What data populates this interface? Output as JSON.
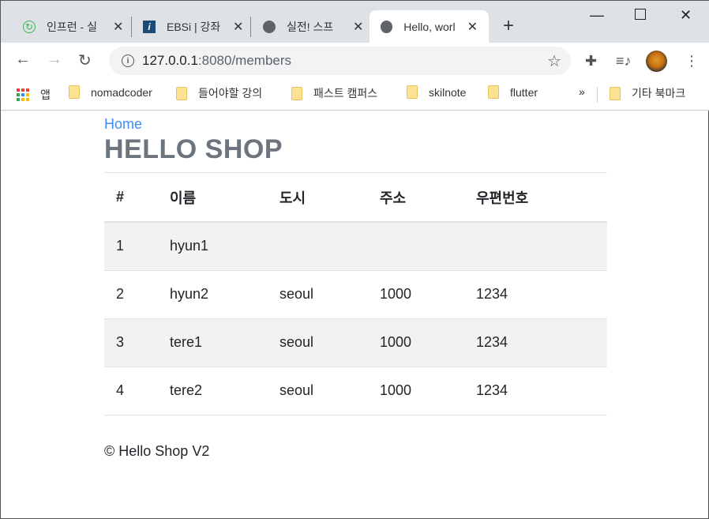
{
  "browser": {
    "tabs": [
      {
        "title": "인프런 - 실",
        "icon": "inflearn-icon"
      },
      {
        "title": "EBSi | 강좌",
        "icon": "ebsi-icon"
      },
      {
        "title": "실전! 스프",
        "icon": "globe-icon"
      },
      {
        "title": "Hello, worl",
        "icon": "globe-icon",
        "active": true
      }
    ],
    "url_host": "127.0.0.1",
    "url_path": ":8080/members",
    "bookmarks": [
      "앱",
      "nomadcoder",
      "들어야할 강의",
      "패스트 캠퍼스",
      "skilnote",
      "flutter"
    ],
    "overflow": "»",
    "other_bookmarks": "기타 북마크"
  },
  "page": {
    "home_link": "Home",
    "title": "HELLO SHOP",
    "table": {
      "headers": [
        "#",
        "이름",
        "도시",
        "주소",
        "우편번호"
      ],
      "rows": [
        [
          "1",
          "hyun1",
          "",
          "",
          ""
        ],
        [
          "2",
          "hyun2",
          "seoul",
          "1000",
          "1234"
        ],
        [
          "3",
          "tere1",
          "seoul",
          "1000",
          "1234"
        ],
        [
          "4",
          "tere2",
          "seoul",
          "1000",
          "1234"
        ]
      ]
    },
    "footer": "© Hello Shop V2"
  }
}
